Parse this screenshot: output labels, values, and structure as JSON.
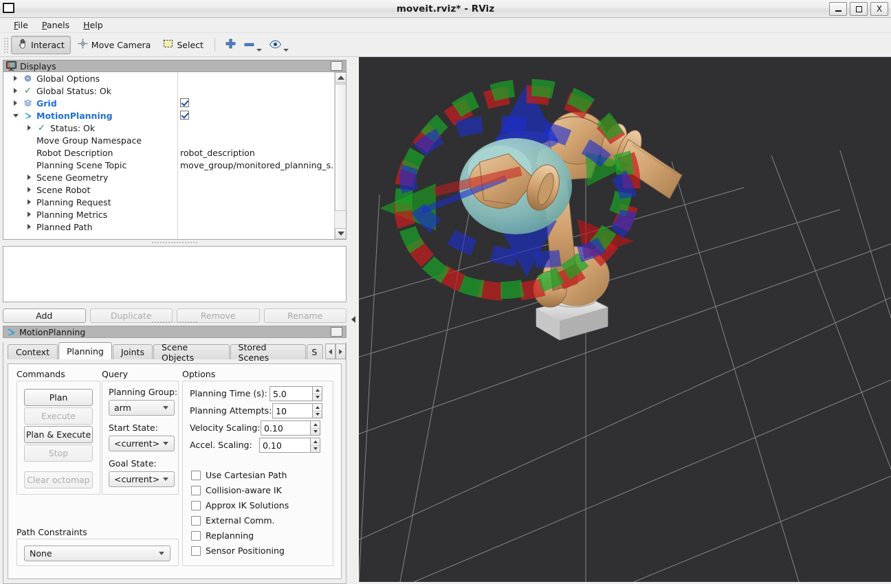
{
  "window": {
    "title": "moveit.rviz* - RViz",
    "app_icon": "window-icon",
    "minimize": "_",
    "maximize": "□",
    "close": "X"
  },
  "menubar": {
    "items": [
      {
        "label": "File",
        "mnemonic": "F"
      },
      {
        "label": "Panels",
        "mnemonic": "P"
      },
      {
        "label": "Help",
        "mnemonic": "H"
      }
    ]
  },
  "toolbar": {
    "tools": [
      {
        "label": "Interact",
        "icon": "hand-cursor-icon",
        "active": true
      },
      {
        "label": "Move Camera",
        "icon": "move-camera-icon",
        "active": false
      },
      {
        "label": "Select",
        "icon": "select-rectangle-icon",
        "active": false
      }
    ],
    "icon_buttons": [
      {
        "icon": "plus-icon",
        "has_dropdown": false
      },
      {
        "icon": "minus-icon",
        "has_dropdown": true
      },
      {
        "icon": "eye-icon",
        "has_dropdown": true
      }
    ]
  },
  "displays": {
    "title": "Displays",
    "icon": "monitor-icon",
    "float_button": "float-panel-button",
    "tree": [
      {
        "label": "Global Options",
        "icon": "gear-icon",
        "expander": "right",
        "indent": 0,
        "value": "",
        "check": false,
        "bold": false
      },
      {
        "label": "Global Status: Ok",
        "icon": "check-icon",
        "expander": "right",
        "indent": 0,
        "value": "",
        "check": false,
        "bold": false
      },
      {
        "label": "Grid",
        "icon": "grid-icon",
        "expander": "right",
        "indent": 0,
        "value": "",
        "check": true,
        "bold": true
      },
      {
        "label": "MotionPlanning",
        "icon": "motionplanning-icon",
        "expander": "down",
        "indent": 0,
        "value": "",
        "check": true,
        "bold": true
      },
      {
        "label": "Status: Ok",
        "icon": "check-icon",
        "expander": "right",
        "indent": 1,
        "value": "",
        "check": false,
        "bold": false
      },
      {
        "label": "Move Group Namespace",
        "icon": "",
        "expander": "",
        "indent": 1,
        "value": "",
        "check": false,
        "bold": false
      },
      {
        "label": "Robot Description",
        "icon": "",
        "expander": "",
        "indent": 1,
        "value": "robot_description",
        "check": false,
        "bold": false
      },
      {
        "label": "Planning Scene Topic",
        "icon": "",
        "expander": "",
        "indent": 1,
        "value": "move_group/monitored_planning_s...",
        "check": false,
        "bold": false
      },
      {
        "label": "Scene Geometry",
        "icon": "",
        "expander": "right",
        "indent": 1,
        "value": "",
        "check": false,
        "bold": false
      },
      {
        "label": "Scene Robot",
        "icon": "",
        "expander": "right",
        "indent": 1,
        "value": "",
        "check": false,
        "bold": false
      },
      {
        "label": "Planning Request",
        "icon": "",
        "expander": "right",
        "indent": 1,
        "value": "",
        "check": false,
        "bold": false
      },
      {
        "label": "Planning Metrics",
        "icon": "",
        "expander": "right",
        "indent": 1,
        "value": "",
        "check": false,
        "bold": false
      },
      {
        "label": "Planned Path",
        "icon": "",
        "expander": "right",
        "indent": 1,
        "value": "",
        "check": false,
        "bold": false
      }
    ],
    "buttons": [
      {
        "label": "Add",
        "enabled": true
      },
      {
        "label": "Duplicate",
        "enabled": false
      },
      {
        "label": "Remove",
        "enabled": false
      },
      {
        "label": "Rename",
        "enabled": false
      }
    ]
  },
  "motion_planning": {
    "title": "MotionPlanning",
    "icon": "motionplanning-icon",
    "float_button": "float-panel-button",
    "tabs": [
      {
        "label": "Context",
        "selected": false
      },
      {
        "label": "Planning",
        "selected": true
      },
      {
        "label": "Joints",
        "selected": false
      },
      {
        "label": "Scene Objects",
        "selected": false
      },
      {
        "label": "Stored Scenes",
        "selected": false
      },
      {
        "label": "S",
        "selected": false,
        "clipped": true
      }
    ],
    "tab_scroll_left": "scroll-left-arrow",
    "tab_scroll_right": "scroll-right-arrow",
    "planning": {
      "commands": {
        "title": "Commands",
        "buttons": [
          {
            "label": "Plan",
            "enabled": true
          },
          {
            "label": "Execute",
            "enabled": false
          },
          {
            "label": "Plan & Execute",
            "enabled": true
          },
          {
            "label": "Stop",
            "enabled": false
          },
          {
            "label": "Clear octomap",
            "enabled": false
          }
        ]
      },
      "query": {
        "title": "Query",
        "fields": [
          {
            "label": "Planning Group:",
            "value": "arm"
          },
          {
            "label": "Start State:",
            "value": "<current>"
          },
          {
            "label": "Goal State:",
            "value": "<current>"
          }
        ]
      },
      "options": {
        "title": "Options",
        "spinners": [
          {
            "label": "Planning Time (s):",
            "value": "5.0"
          },
          {
            "label": "Planning Attempts:",
            "value": "10"
          },
          {
            "label": "Velocity Scaling:",
            "value": "0.10"
          },
          {
            "label": "Accel. Scaling:",
            "value": "0.10"
          }
        ],
        "checkboxes": [
          {
            "label": "Use Cartesian Path",
            "checked": false
          },
          {
            "label": "Collision-aware IK",
            "checked": false
          },
          {
            "label": "Approx IK Solutions",
            "checked": false
          },
          {
            "label": "External Comm.",
            "checked": false
          },
          {
            "label": "Replanning",
            "checked": false
          },
          {
            "label": "Sensor Positioning",
            "checked": false
          }
        ]
      },
      "path_constraints": {
        "title": "Path Constraints",
        "value": "None"
      }
    }
  },
  "viewport": {
    "name": "3d-render-view",
    "background_color": "#303033",
    "grid_color": "#b9b9b9",
    "robot": {
      "link_color": "#d2a574",
      "base_color": "#cfcfcf",
      "ghost_color": "#8fc5c2"
    },
    "interactive_marker": {
      "axis_colors": {
        "x": "#cc1111",
        "y": "#11aa22",
        "z": "#1122cc"
      },
      "rings": 3,
      "arrows": 6
    },
    "collapse_left": "collapse-left-arrow",
    "collapse_right": "collapse-right-arrow"
  }
}
